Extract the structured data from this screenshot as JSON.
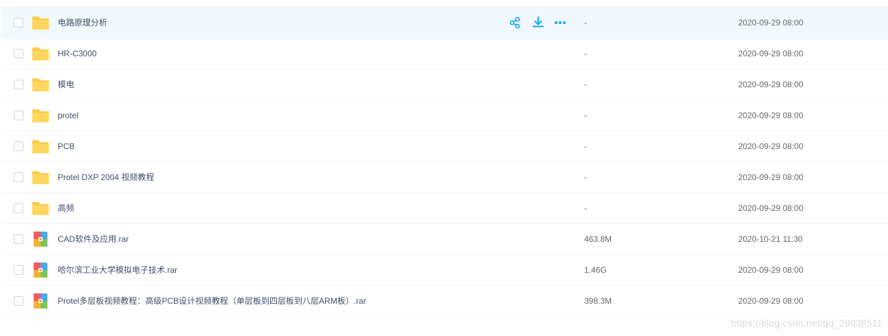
{
  "colors": {
    "accent": "#06a7ff",
    "folder": "#ffc94d",
    "row_hover": "#f1f9fe"
  },
  "rows": [
    {
      "name": "电路原理分析",
      "size": "-",
      "time": "2020-09-29 08:00",
      "icon": "folder-icon"
    },
    {
      "name": "HR-C3000",
      "size": "-",
      "time": "2020-09-29 08:00",
      "icon": "folder-icon"
    },
    {
      "name": "模电",
      "size": "-",
      "time": "2020-09-29 08:00",
      "icon": "folder-icon"
    },
    {
      "name": "protel",
      "size": "-",
      "time": "2020-09-29 08:00",
      "icon": "folder-icon"
    },
    {
      "name": "PCB",
      "size": "-",
      "time": "2020-09-29 08:00",
      "icon": "folder-icon"
    },
    {
      "name": "Protel DXP 2004 视频教程",
      "size": "-",
      "time": "2020-09-29 08:00",
      "icon": "folder-icon"
    },
    {
      "name": "高频",
      "size": "-",
      "time": "2020-09-29 08:00",
      "icon": "folder-icon"
    },
    {
      "name": "CAD软件及应用.rar",
      "size": "463.8M",
      "time": "2020-10-21 11:30",
      "icon": "rar-archive-icon"
    },
    {
      "name": "哈尔滨工业大学模拟电子技术.rar",
      "size": "1.46G",
      "time": "2020-09-29 08:00",
      "icon": "rar-archive-icon"
    },
    {
      "name": "Protel多层板视频教程：高级PCB设计视频教程（单层板到四层板到八层ARM板）.rar",
      "size": "398.3M",
      "time": "2020-09-29 08:00",
      "icon": "rar-archive-icon"
    }
  ],
  "hover_actions": [
    "share-icon",
    "download-icon",
    "more-icon"
  ],
  "watermark": "https://blog.csdn.net/qq_28938511"
}
